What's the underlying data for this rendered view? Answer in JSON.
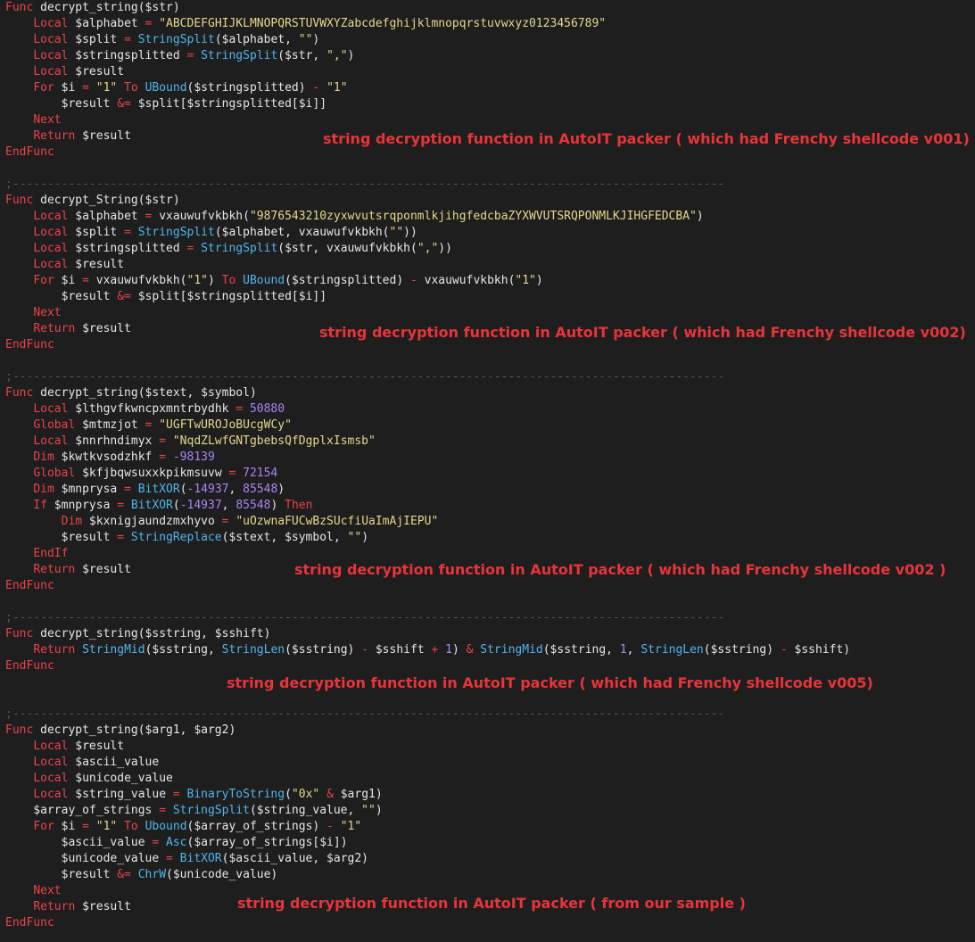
{
  "colors": {
    "background": "#1e1e1e",
    "keyword": "#e8434c",
    "identifier": "#e6e6e6",
    "string": "#e2d98a",
    "builtin_function": "#4fb5ec",
    "number": "#a886f3",
    "comment_separator": "#555555",
    "annotation": "#e8343a"
  },
  "code_lines": [
    [
      {
        "t": "kw",
        "v": "Func"
      },
      {
        "t": "id",
        "v": " decrypt_string($str)"
      }
    ],
    [
      {
        "t": "id",
        "v": "    "
      },
      {
        "t": "kw",
        "v": "Local"
      },
      {
        "t": "id",
        "v": " $alphabet "
      },
      {
        "t": "op",
        "v": "="
      },
      {
        "t": "id",
        "v": " "
      },
      {
        "t": "str",
        "v": "\"ABCDEFGHIJKLMNOPQRSTUVWXYZabcdefghijklmnopqrstuvwxyz0123456789\""
      }
    ],
    [
      {
        "t": "id",
        "v": "    "
      },
      {
        "t": "kw",
        "v": "Local"
      },
      {
        "t": "id",
        "v": " $split "
      },
      {
        "t": "op",
        "v": "="
      },
      {
        "t": "id",
        "v": " "
      },
      {
        "t": "fn",
        "v": "StringSplit"
      },
      {
        "t": "id",
        "v": "($alphabet, "
      },
      {
        "t": "str",
        "v": "\"\""
      },
      {
        "t": "id",
        "v": ")"
      }
    ],
    [
      {
        "t": "id",
        "v": "    "
      },
      {
        "t": "kw",
        "v": "Local"
      },
      {
        "t": "id",
        "v": " $stringsplitted "
      },
      {
        "t": "op",
        "v": "="
      },
      {
        "t": "id",
        "v": " "
      },
      {
        "t": "fn",
        "v": "StringSplit"
      },
      {
        "t": "id",
        "v": "($str, "
      },
      {
        "t": "str",
        "v": "\",\""
      },
      {
        "t": "id",
        "v": ")"
      }
    ],
    [
      {
        "t": "id",
        "v": "    "
      },
      {
        "t": "kw",
        "v": "Local"
      },
      {
        "t": "id",
        "v": " $result"
      }
    ],
    [
      {
        "t": "id",
        "v": "    "
      },
      {
        "t": "kw",
        "v": "For"
      },
      {
        "t": "id",
        "v": " $i "
      },
      {
        "t": "op",
        "v": "="
      },
      {
        "t": "id",
        "v": " "
      },
      {
        "t": "str",
        "v": "\"1\""
      },
      {
        "t": "id",
        "v": " "
      },
      {
        "t": "kw",
        "v": "To"
      },
      {
        "t": "id",
        "v": " "
      },
      {
        "t": "fn",
        "v": "UBound"
      },
      {
        "t": "id",
        "v": "($stringsplitted) "
      },
      {
        "t": "op",
        "v": "-"
      },
      {
        "t": "id",
        "v": " "
      },
      {
        "t": "str",
        "v": "\"1\""
      }
    ],
    [
      {
        "t": "id",
        "v": "        $result "
      },
      {
        "t": "op",
        "v": "&="
      },
      {
        "t": "id",
        "v": " $split[$stringsplitted[$i]]"
      }
    ],
    [
      {
        "t": "id",
        "v": "    "
      },
      {
        "t": "kw",
        "v": "Next"
      }
    ],
    [
      {
        "t": "id",
        "v": "    "
      },
      {
        "t": "kw",
        "v": "Return"
      },
      {
        "t": "id",
        "v": " $result"
      }
    ],
    [
      {
        "t": "kw",
        "v": "EndFunc"
      }
    ],
    [],
    [
      {
        "t": "cmt",
        "v": ";------------------------------------------------------------------------------------------------------"
      }
    ],
    [
      {
        "t": "kw",
        "v": "Func"
      },
      {
        "t": "id",
        "v": " decrypt_String($str)"
      }
    ],
    [
      {
        "t": "id",
        "v": "    "
      },
      {
        "t": "kw",
        "v": "Local"
      },
      {
        "t": "id",
        "v": " $alphabet "
      },
      {
        "t": "op",
        "v": "="
      },
      {
        "t": "id",
        "v": " vxauwufvkbkh("
      },
      {
        "t": "str",
        "v": "\"9876543210zyxwvutsrqponmlkjihgfedcbaZYXWVUTSRQPONMLKJIHGFEDCBA\""
      },
      {
        "t": "id",
        "v": ")"
      }
    ],
    [
      {
        "t": "id",
        "v": "    "
      },
      {
        "t": "kw",
        "v": "Local"
      },
      {
        "t": "id",
        "v": " $split "
      },
      {
        "t": "op",
        "v": "="
      },
      {
        "t": "id",
        "v": " "
      },
      {
        "t": "fn",
        "v": "StringSplit"
      },
      {
        "t": "id",
        "v": "($alphabet, vxauwufvkbkh("
      },
      {
        "t": "str",
        "v": "\"\""
      },
      {
        "t": "id",
        "v": "))"
      }
    ],
    [
      {
        "t": "id",
        "v": "    "
      },
      {
        "t": "kw",
        "v": "Local"
      },
      {
        "t": "id",
        "v": " $stringsplitted "
      },
      {
        "t": "op",
        "v": "="
      },
      {
        "t": "id",
        "v": " "
      },
      {
        "t": "fn",
        "v": "StringSplit"
      },
      {
        "t": "id",
        "v": "($str, vxauwufvkbkh("
      },
      {
        "t": "str",
        "v": "\",\""
      },
      {
        "t": "id",
        "v": "))"
      }
    ],
    [
      {
        "t": "id",
        "v": "    "
      },
      {
        "t": "kw",
        "v": "Local"
      },
      {
        "t": "id",
        "v": " $result"
      }
    ],
    [
      {
        "t": "id",
        "v": "    "
      },
      {
        "t": "kw",
        "v": "For"
      },
      {
        "t": "id",
        "v": " $i "
      },
      {
        "t": "op",
        "v": "="
      },
      {
        "t": "id",
        "v": " vxauwufvkbkh("
      },
      {
        "t": "str",
        "v": "\"1\""
      },
      {
        "t": "id",
        "v": ") "
      },
      {
        "t": "kw",
        "v": "To"
      },
      {
        "t": "id",
        "v": " "
      },
      {
        "t": "fn",
        "v": "UBound"
      },
      {
        "t": "id",
        "v": "($stringsplitted) "
      },
      {
        "t": "op",
        "v": "-"
      },
      {
        "t": "id",
        "v": " vxauwufvkbkh("
      },
      {
        "t": "str",
        "v": "\"1\""
      },
      {
        "t": "id",
        "v": ")"
      }
    ],
    [
      {
        "t": "id",
        "v": "        $result "
      },
      {
        "t": "op",
        "v": "&="
      },
      {
        "t": "id",
        "v": " $split[$stringsplitted[$i]]"
      }
    ],
    [
      {
        "t": "id",
        "v": "    "
      },
      {
        "t": "kw",
        "v": "Next"
      }
    ],
    [
      {
        "t": "id",
        "v": "    "
      },
      {
        "t": "kw",
        "v": "Return"
      },
      {
        "t": "id",
        "v": " $result"
      }
    ],
    [
      {
        "t": "kw",
        "v": "EndFunc"
      }
    ],
    [],
    [
      {
        "t": "cmt",
        "v": ";------------------------------------------------------------------------------------------------------"
      }
    ],
    [
      {
        "t": "kw",
        "v": "Func"
      },
      {
        "t": "id",
        "v": " decrypt_string($stext, $symbol)"
      }
    ],
    [
      {
        "t": "id",
        "v": "    "
      },
      {
        "t": "kw",
        "v": "Local"
      },
      {
        "t": "id",
        "v": " $lthgvfkwncpxmntrbydhk "
      },
      {
        "t": "op",
        "v": "="
      },
      {
        "t": "id",
        "v": " "
      },
      {
        "t": "num",
        "v": "50880"
      }
    ],
    [
      {
        "t": "id",
        "v": "    "
      },
      {
        "t": "kw",
        "v": "Global"
      },
      {
        "t": "id",
        "v": " $mtmzjot "
      },
      {
        "t": "op",
        "v": "="
      },
      {
        "t": "id",
        "v": " "
      },
      {
        "t": "str",
        "v": "\"UGFTwUROJoBUcgWCy\""
      }
    ],
    [
      {
        "t": "id",
        "v": "    "
      },
      {
        "t": "kw",
        "v": "Local"
      },
      {
        "t": "id",
        "v": " $nnrhndimyx "
      },
      {
        "t": "op",
        "v": "="
      },
      {
        "t": "id",
        "v": " "
      },
      {
        "t": "str",
        "v": "\"NqdZLwfGNTgbebsQfDgplxIsmsb\""
      }
    ],
    [
      {
        "t": "id",
        "v": "    "
      },
      {
        "t": "kw",
        "v": "Dim"
      },
      {
        "t": "id",
        "v": " $kwtkvsodzhkf "
      },
      {
        "t": "op",
        "v": "="
      },
      {
        "t": "id",
        "v": " "
      },
      {
        "t": "num",
        "v": "-98139"
      }
    ],
    [
      {
        "t": "id",
        "v": "    "
      },
      {
        "t": "kw",
        "v": "Global"
      },
      {
        "t": "id",
        "v": " $kfjbqwsuxxkpikmsuvw "
      },
      {
        "t": "op",
        "v": "="
      },
      {
        "t": "id",
        "v": " "
      },
      {
        "t": "num",
        "v": "72154"
      }
    ],
    [
      {
        "t": "id",
        "v": "    "
      },
      {
        "t": "kw",
        "v": "Dim"
      },
      {
        "t": "id",
        "v": " $mnprysa "
      },
      {
        "t": "op",
        "v": "="
      },
      {
        "t": "id",
        "v": " "
      },
      {
        "t": "fn",
        "v": "BitXOR"
      },
      {
        "t": "id",
        "v": "("
      },
      {
        "t": "num",
        "v": "-14937"
      },
      {
        "t": "id",
        "v": ", "
      },
      {
        "t": "num",
        "v": "85548"
      },
      {
        "t": "id",
        "v": ")"
      }
    ],
    [
      {
        "t": "id",
        "v": "    "
      },
      {
        "t": "kw",
        "v": "If"
      },
      {
        "t": "id",
        "v": " $mnprysa "
      },
      {
        "t": "op",
        "v": "="
      },
      {
        "t": "id",
        "v": " "
      },
      {
        "t": "fn",
        "v": "BitXOR"
      },
      {
        "t": "id",
        "v": "("
      },
      {
        "t": "num",
        "v": "-14937"
      },
      {
        "t": "id",
        "v": ", "
      },
      {
        "t": "num",
        "v": "85548"
      },
      {
        "t": "id",
        "v": ") "
      },
      {
        "t": "kw",
        "v": "Then"
      }
    ],
    [
      {
        "t": "id",
        "v": "        "
      },
      {
        "t": "kw",
        "v": "Dim"
      },
      {
        "t": "id",
        "v": " $kxnigjaundzmxhyvo "
      },
      {
        "t": "op",
        "v": "="
      },
      {
        "t": "id",
        "v": " "
      },
      {
        "t": "str",
        "v": "\"uOzwnaFUCwBzSUcfiUaImAjIEPU\""
      }
    ],
    [
      {
        "t": "id",
        "v": "        $result "
      },
      {
        "t": "op",
        "v": "="
      },
      {
        "t": "id",
        "v": " "
      },
      {
        "t": "fn",
        "v": "StringReplace"
      },
      {
        "t": "id",
        "v": "($stext, $symbol, "
      },
      {
        "t": "str",
        "v": "\"\""
      },
      {
        "t": "id",
        "v": ")"
      }
    ],
    [
      {
        "t": "id",
        "v": "    "
      },
      {
        "t": "kw",
        "v": "EndIf"
      }
    ],
    [
      {
        "t": "id",
        "v": "    "
      },
      {
        "t": "kw",
        "v": "Return"
      },
      {
        "t": "id",
        "v": " $result"
      }
    ],
    [
      {
        "t": "kw",
        "v": "EndFunc"
      }
    ],
    [],
    [
      {
        "t": "cmt",
        "v": ";------------------------------------------------------------------------------------------------------"
      }
    ],
    [
      {
        "t": "kw",
        "v": "Func"
      },
      {
        "t": "id",
        "v": " decrypt_string($sstring, $sshift)"
      }
    ],
    [
      {
        "t": "id",
        "v": "    "
      },
      {
        "t": "kw",
        "v": "Return"
      },
      {
        "t": "id",
        "v": " "
      },
      {
        "t": "fn",
        "v": "StringMid"
      },
      {
        "t": "id",
        "v": "($sstring, "
      },
      {
        "t": "fn",
        "v": "StringLen"
      },
      {
        "t": "id",
        "v": "($sstring) "
      },
      {
        "t": "op",
        "v": "-"
      },
      {
        "t": "id",
        "v": " $sshift "
      },
      {
        "t": "op",
        "v": "+"
      },
      {
        "t": "id",
        "v": " "
      },
      {
        "t": "num",
        "v": "1"
      },
      {
        "t": "id",
        "v": ") "
      },
      {
        "t": "op",
        "v": "&"
      },
      {
        "t": "id",
        "v": " "
      },
      {
        "t": "fn",
        "v": "StringMid"
      },
      {
        "t": "id",
        "v": "($sstring, "
      },
      {
        "t": "num",
        "v": "1"
      },
      {
        "t": "id",
        "v": ", "
      },
      {
        "t": "fn",
        "v": "StringLen"
      },
      {
        "t": "id",
        "v": "($sstring) "
      },
      {
        "t": "op",
        "v": "-"
      },
      {
        "t": "id",
        "v": " $sshift)"
      }
    ],
    [
      {
        "t": "kw",
        "v": "EndFunc"
      }
    ],
    [],
    [],
    [
      {
        "t": "cmt",
        "v": ";------------------------------------------------------------------------------------------------------"
      }
    ],
    [
      {
        "t": "kw",
        "v": "Func"
      },
      {
        "t": "id",
        "v": " decrypt_string($arg1, $arg2)"
      }
    ],
    [
      {
        "t": "id",
        "v": "    "
      },
      {
        "t": "kw",
        "v": "Local"
      },
      {
        "t": "id",
        "v": " $result"
      }
    ],
    [
      {
        "t": "id",
        "v": "    "
      },
      {
        "t": "kw",
        "v": "Local"
      },
      {
        "t": "id",
        "v": " $ascii_value"
      }
    ],
    [
      {
        "t": "id",
        "v": "    "
      },
      {
        "t": "kw",
        "v": "Local"
      },
      {
        "t": "id",
        "v": " $unicode_value"
      }
    ],
    [
      {
        "t": "id",
        "v": "    "
      },
      {
        "t": "kw",
        "v": "Local"
      },
      {
        "t": "id",
        "v": " $string_value "
      },
      {
        "t": "op",
        "v": "="
      },
      {
        "t": "id",
        "v": " "
      },
      {
        "t": "fn",
        "v": "BinaryToString"
      },
      {
        "t": "id",
        "v": "("
      },
      {
        "t": "str",
        "v": "\"0x\""
      },
      {
        "t": "id",
        "v": " "
      },
      {
        "t": "op",
        "v": "&"
      },
      {
        "t": "id",
        "v": " $arg1)"
      }
    ],
    [
      {
        "t": "id",
        "v": "    $array_of_strings "
      },
      {
        "t": "op",
        "v": "="
      },
      {
        "t": "id",
        "v": " "
      },
      {
        "t": "fn",
        "v": "StringSplit"
      },
      {
        "t": "id",
        "v": "($string_value, "
      },
      {
        "t": "str",
        "v": "\"\""
      },
      {
        "t": "id",
        "v": ")"
      }
    ],
    [
      {
        "t": "id",
        "v": "    "
      },
      {
        "t": "kw",
        "v": "For"
      },
      {
        "t": "id",
        "v": " $i "
      },
      {
        "t": "op",
        "v": "="
      },
      {
        "t": "id",
        "v": " "
      },
      {
        "t": "str",
        "v": "\"1\""
      },
      {
        "t": "id",
        "v": " "
      },
      {
        "t": "kw",
        "v": "To"
      },
      {
        "t": "id",
        "v": " "
      },
      {
        "t": "fn",
        "v": "Ubound"
      },
      {
        "t": "id",
        "v": "($array_of_strings) "
      },
      {
        "t": "op",
        "v": "-"
      },
      {
        "t": "id",
        "v": " "
      },
      {
        "t": "str",
        "v": "\"1\""
      }
    ],
    [
      {
        "t": "id",
        "v": "        $ascii_value "
      },
      {
        "t": "op",
        "v": "="
      },
      {
        "t": "id",
        "v": " "
      },
      {
        "t": "fn",
        "v": "Asc"
      },
      {
        "t": "id",
        "v": "($array_of_strings[$i])"
      }
    ],
    [
      {
        "t": "id",
        "v": "        $unicode_value "
      },
      {
        "t": "op",
        "v": "="
      },
      {
        "t": "id",
        "v": " "
      },
      {
        "t": "fn",
        "v": "BitXOR"
      },
      {
        "t": "id",
        "v": "($ascii_value, $arg2)"
      }
    ],
    [
      {
        "t": "id",
        "v": "        $result "
      },
      {
        "t": "op",
        "v": "&="
      },
      {
        "t": "id",
        "v": " "
      },
      {
        "t": "fn",
        "v": "ChrW"
      },
      {
        "t": "id",
        "v": "($unicode_value)"
      }
    ],
    [
      {
        "t": "id",
        "v": "    "
      },
      {
        "t": "kw",
        "v": "Next"
      }
    ],
    [
      {
        "t": "id",
        "v": "    "
      },
      {
        "t": "kw",
        "v": "Return"
      },
      {
        "t": "id",
        "v": " $result"
      }
    ],
    [
      {
        "t": "kw",
        "v": "EndFunc"
      }
    ]
  ],
  "annotations": [
    {
      "text": "string decryption function in AutoIT packer ( which had Frenchy shellcode v001)"
    },
    {
      "text": "string decryption function in AutoIT packer ( which had Frenchy shellcode v002)"
    },
    {
      "text": "string decryption function in AutoIT packer ( which had Frenchy shellcode v002 )"
    },
    {
      "text": "string decryption function in AutoIT packer ( which had Frenchy shellcode v005)"
    },
    {
      "text": "string decryption function in AutoIT packer ( from our sample )"
    }
  ]
}
